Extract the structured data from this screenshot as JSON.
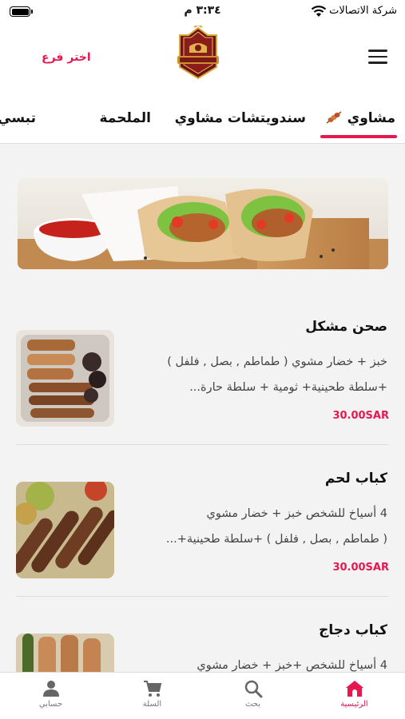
{
  "status_bar": {
    "carrier": "شركة الاتصالات",
    "time": "٣:٣٤ م",
    "battery_level": 1.0
  },
  "header": {
    "choose_branch": "اختر فرع",
    "menu_icon": "hamburger-icon",
    "logo": "restaurant-logo"
  },
  "tabs": [
    {
      "label": "مشاوي",
      "active": true,
      "icon": "grill-skewer-icon"
    },
    {
      "label": "سندويتشات مشاوي",
      "active": false
    },
    {
      "label": "الملحمة",
      "active": false
    },
    {
      "label": "تبسي",
      "active": false
    }
  ],
  "banner": {
    "image": "shawarma-wrap-banner"
  },
  "products": [
    {
      "name": "صحن مشكل",
      "desc_line1": "خبز + خضار مشوي ( طماطم , بصل , فلفل )",
      "desc_line2": "+سلطة طحينية+ ثومية + سلطة حارة...",
      "price": "30.00SAR",
      "image": "mixed-grill-plate"
    },
    {
      "name": "كباب لحم",
      "desc_line1": "4 أسياخ للشخص خبز + خضار مشوي",
      "desc_line2": "( طماطم , بصل , فلفل ) +سلطة طحينية+...",
      "price": "30.00SAR",
      "image": "meat-kebab"
    },
    {
      "name": "كباب دجاج",
      "desc_line1": "4 أسياخ للشخص +خبز + خضار مشوي",
      "desc_line2": "",
      "price": "",
      "image": "chicken-kebab"
    }
  ],
  "bottom_nav": [
    {
      "label": "الرئيسية",
      "icon": "home-icon",
      "active": true
    },
    {
      "label": "بحث",
      "icon": "search-icon",
      "active": false
    },
    {
      "label": "السلة",
      "icon": "cart-icon",
      "active": false
    },
    {
      "label": "حسابي",
      "icon": "account-icon",
      "active": false
    }
  ],
  "colors": {
    "accent": "#e5194f",
    "background": "#f3f3f3",
    "surface": "#ffffff"
  }
}
